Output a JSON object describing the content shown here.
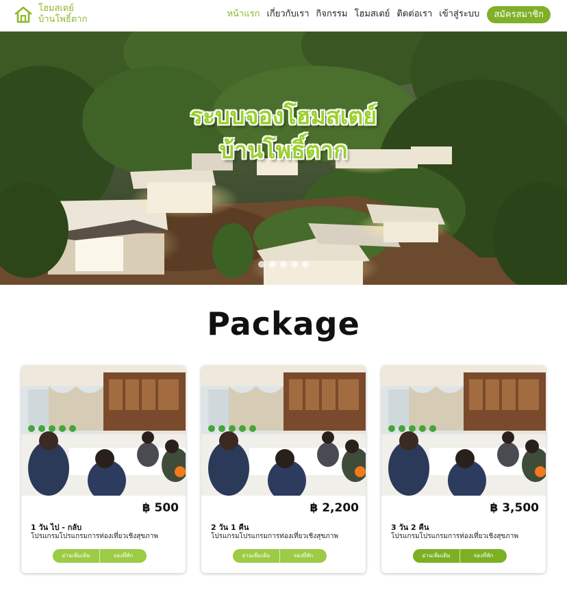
{
  "brand": {
    "line1": "โฮมสเตย์",
    "line2": "บ้านโพธิ์ตาก",
    "icon": "house-icon",
    "color": "#8cb82a"
  },
  "nav": {
    "items": [
      {
        "label": "หน้าแรก",
        "active": true
      },
      {
        "label": "เกี่ยวกับเรา",
        "active": false
      },
      {
        "label": "กิจกรรม",
        "active": false
      },
      {
        "label": "โฮมสเตย์",
        "active": false
      },
      {
        "label": "ติดต่อเรา",
        "active": false
      },
      {
        "label": "เข้าสู่ระบบ",
        "active": false
      }
    ],
    "signup_label": "สมัครสมาชิก"
  },
  "hero": {
    "title_line1": "ระบบจองโฮมสเตย์",
    "title_line2": "บ้านโพธิ์ตาก",
    "slide_count": 5
  },
  "section": {
    "title": "Package"
  },
  "packages": [
    {
      "price": "฿ 500",
      "title": "1 วัน ไป - กลับ",
      "description": "โปรแกรมโปรแกรมการท่องเที่ยวเชิงสุขภาพ",
      "more_label": "อ่านเพิ่มเติม",
      "book_label": "จองที่พัก"
    },
    {
      "price": "฿ 2,200",
      "title": "2 วัน 1 คืน",
      "description": "โปรแกรมโปรแกรมการท่องเที่ยวเชิงสุขภาพ",
      "more_label": "อ่านเพิ่มเติม",
      "book_label": "จองที่พัก"
    },
    {
      "price": "฿ 3,500",
      "title": "3 วัน 2 คืน",
      "description": "โปรแกรมโปรแกรมการท่องเที่ยวเชิงสุขภาพ",
      "more_label": "อ่านเพิ่มเติม",
      "book_label": "จองที่พัก"
    }
  ],
  "colors": {
    "accent": "#8cb82a",
    "button": "#7fb028"
  }
}
